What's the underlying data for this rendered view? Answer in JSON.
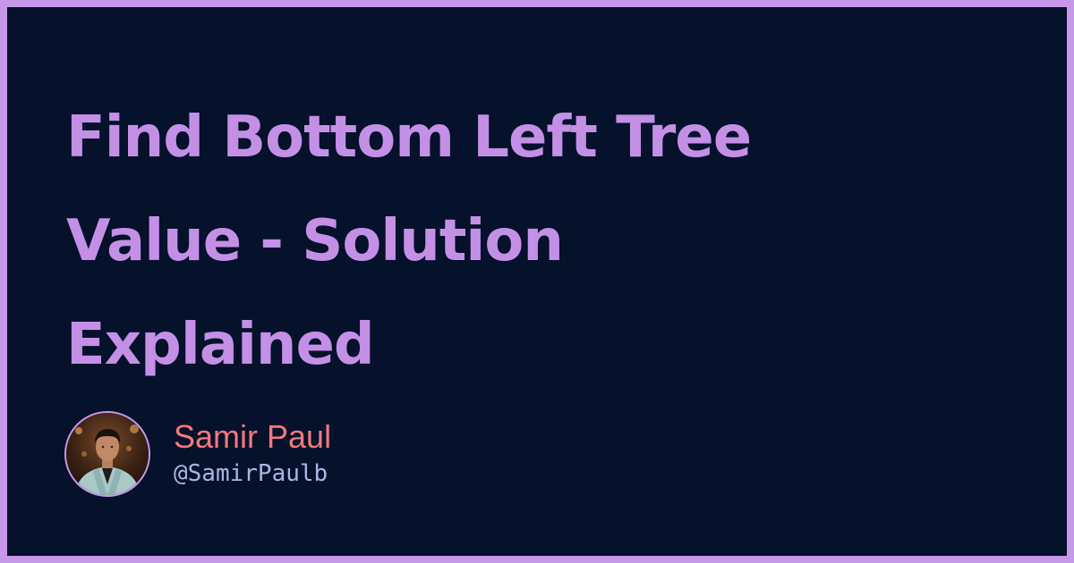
{
  "title": {
    "line1": "Find Bottom Left Tree",
    "line2": "Value - Solution",
    "line3": "Explained"
  },
  "author": {
    "name": "Samir Paul",
    "handle": "@SamirPaulb",
    "avatar_icon": "avatar-photo"
  },
  "colors": {
    "border": "#c698e8",
    "background": "#06112b",
    "title": "#c490e6",
    "author_name": "#f2797c",
    "author_handle": "#a9b7e6"
  }
}
